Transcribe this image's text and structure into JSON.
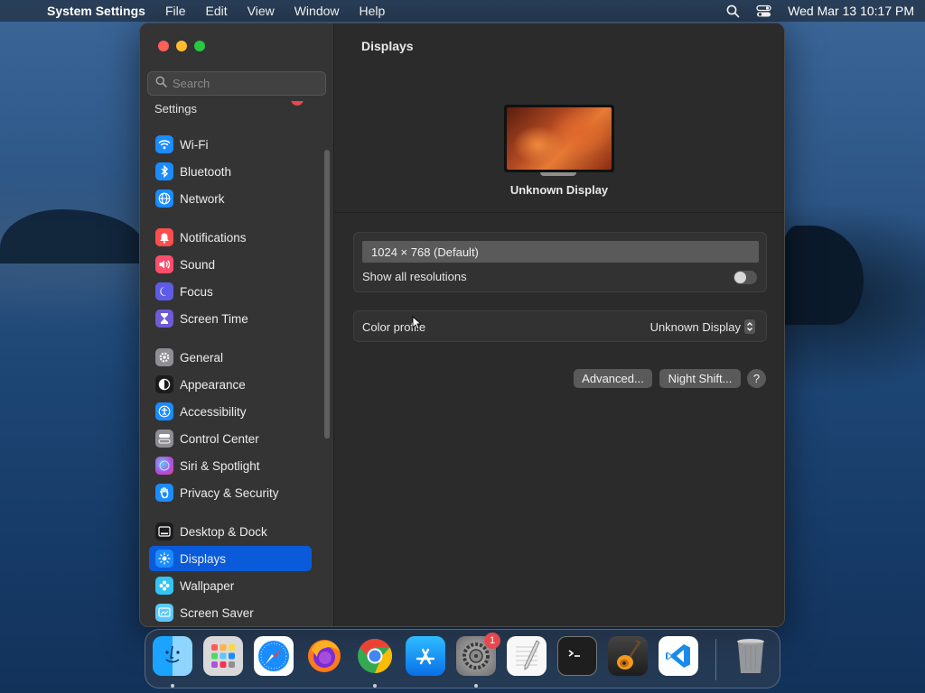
{
  "menubar": {
    "app_name": "System Settings",
    "items": [
      "File",
      "Edit",
      "View",
      "Window",
      "Help"
    ],
    "clock": "Wed Mar 13  10:17 PM"
  },
  "sidebar": {
    "search_placeholder": "Search",
    "cutoff_label": "Settings",
    "items": [
      {
        "label": "Wi-Fi",
        "icon": "wifi-icon",
        "color": "#1a8cff"
      },
      {
        "label": "Bluetooth",
        "icon": "bluetooth-icon",
        "color": "#1a8cff"
      },
      {
        "label": "Network",
        "icon": "globe-icon",
        "color": "#1a8cff"
      },
      {
        "label": "Notifications",
        "icon": "bell-icon",
        "color": "#ff4d4d"
      },
      {
        "label": "Sound",
        "icon": "speaker-icon",
        "color": "#ff4d6d"
      },
      {
        "label": "Focus",
        "icon": "moon-icon",
        "color": "#5e5ce6"
      },
      {
        "label": "Screen Time",
        "icon": "hourglass-icon",
        "color": "#6e5bd6"
      },
      {
        "label": "General",
        "icon": "gear-icon",
        "color": "#8e8e93"
      },
      {
        "label": "Appearance",
        "icon": "appearance-icon",
        "color": "#1c1c1e"
      },
      {
        "label": "Accessibility",
        "icon": "accessibility-icon",
        "color": "#1a8cff"
      },
      {
        "label": "Control Center",
        "icon": "control-center-icon",
        "color": "#8e8e93"
      },
      {
        "label": "Siri & Spotlight",
        "icon": "siri-icon",
        "color": "#b04ddc"
      },
      {
        "label": "Privacy & Security",
        "icon": "hand-icon",
        "color": "#1a8cff"
      },
      {
        "label": "Desktop & Dock",
        "icon": "dock-icon",
        "color": "#1c1c1e"
      },
      {
        "label": "Displays",
        "icon": "sun-icon",
        "color": "#1a8cff"
      },
      {
        "label": "Wallpaper",
        "icon": "wallpaper-icon",
        "color": "#32c5f4"
      },
      {
        "label": "Screen Saver",
        "icon": "screen-saver-icon",
        "color": "#5ac8fa"
      }
    ],
    "selected": "Displays"
  },
  "main": {
    "title": "Displays",
    "display_name": "Unknown Display",
    "resolution": "1024 × 768 (Default)",
    "show_all_label": "Show all resolutions",
    "color_profile_label": "Color profile",
    "color_profile_value": "Unknown Display",
    "advanced_button": "Advanced...",
    "night_shift_button": "Night Shift...",
    "help_button": "?"
  },
  "dock": {
    "apps": [
      {
        "name": "Finder",
        "icon": "finder-icon",
        "running": true
      },
      {
        "name": "Launchpad",
        "icon": "launchpad-icon",
        "running": false
      },
      {
        "name": "Safari",
        "icon": "safari-icon",
        "running": false
      },
      {
        "name": "Firefox",
        "icon": "firefox-icon",
        "running": false
      },
      {
        "name": "Chrome",
        "icon": "chrome-icon",
        "running": true
      },
      {
        "name": "App Store",
        "icon": "app-store-icon",
        "running": false
      },
      {
        "name": "System Settings",
        "icon": "system-settings-icon",
        "running": true,
        "badge": "1"
      },
      {
        "name": "TextEdit",
        "icon": "textedit-icon",
        "running": false
      },
      {
        "name": "Terminal",
        "icon": "terminal-icon",
        "running": false
      },
      {
        "name": "GarageBand",
        "icon": "garageband-icon",
        "running": false
      },
      {
        "name": "VS Code",
        "icon": "vscode-icon",
        "running": false
      },
      {
        "name": "Trash",
        "icon": "trash-icon",
        "running": false
      }
    ]
  }
}
